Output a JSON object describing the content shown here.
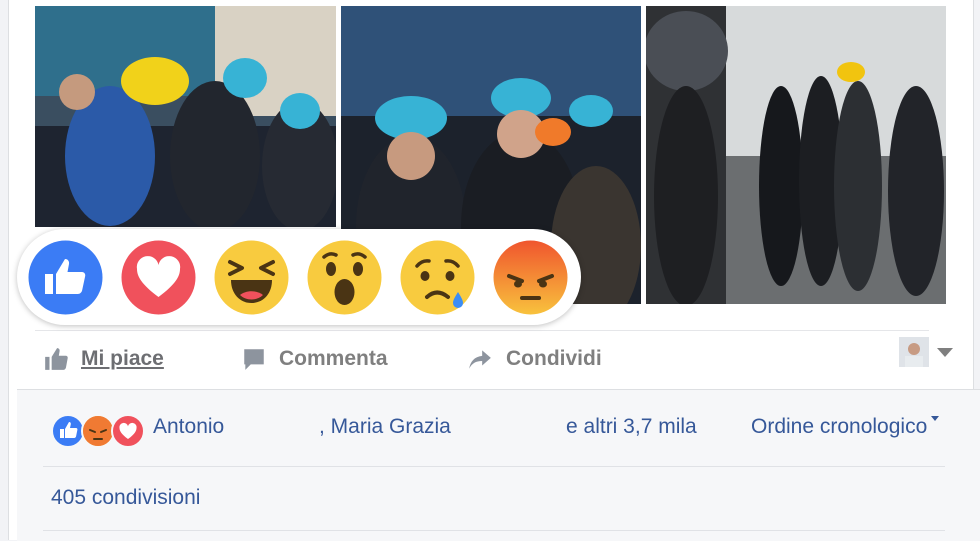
{
  "actions": {
    "like": "Mi piace",
    "comment": "Commenta",
    "share": "Condividi"
  },
  "reactions": [
    {
      "name": "like",
      "icon": "thumbs-up-icon",
      "color": "#3b7cf5"
    },
    {
      "name": "love",
      "icon": "heart-icon",
      "color": "#f0515c"
    },
    {
      "name": "haha",
      "icon": "laughing-face-icon",
      "color": "#f8cb3f"
    },
    {
      "name": "wow",
      "icon": "surprised-face-icon",
      "color": "#f8cb3f"
    },
    {
      "name": "sad",
      "icon": "crying-face-icon",
      "color": "#f8cb3f"
    },
    {
      "name": "angry",
      "icon": "angry-face-icon",
      "color": "#f0713a"
    }
  ],
  "reaction_summary": {
    "icons": [
      "like-icon",
      "angry-icon",
      "love-icon"
    ],
    "name_1": "Antonio",
    "name_2": ", Maria Grazia",
    "others": "e altri 3,7 mila",
    "order": "Ordine cronologico"
  },
  "shares": "405 condivisioni",
  "colors": {
    "link": "#365899",
    "action_text": "#7f7f7f",
    "background": "#f6f7f9"
  }
}
